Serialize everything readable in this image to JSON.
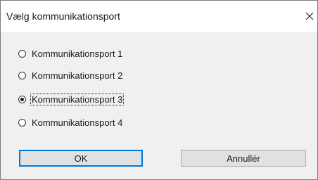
{
  "dialog": {
    "title": "Vælg kommunikationsport",
    "close_icon": "close-icon"
  },
  "options": [
    {
      "label": "Kommunikationsport 1",
      "selected": false
    },
    {
      "label": "Kommunikationsport 2",
      "selected": false
    },
    {
      "label": "Kommunikationsport 3",
      "selected": true
    },
    {
      "label": "Kommunikationsport 4",
      "selected": false
    }
  ],
  "buttons": {
    "ok_label": "OK",
    "cancel_label": "Annullér"
  },
  "colors": {
    "dialog_background": "#f0f0f0",
    "default_button_border": "#0078d7"
  }
}
